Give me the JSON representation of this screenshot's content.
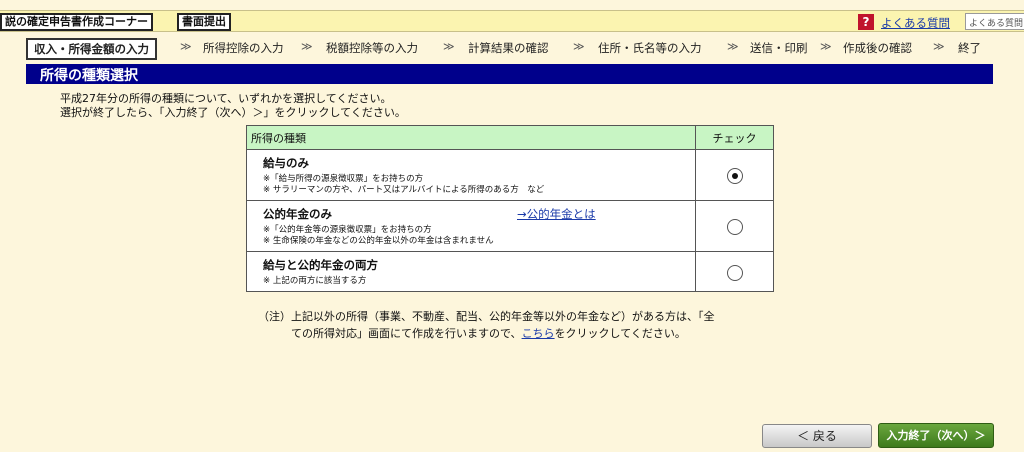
{
  "top": {
    "corner_title": "説の確定申告書作成コーナー",
    "submit_button": "書面提出",
    "faq_icon": "?",
    "faq_link": "よくある質問",
    "search_placeholder": "よくある質問"
  },
  "steps": [
    {
      "label": "収入・所得金額の入力",
      "active": true
    },
    {
      "label": "所得控除の入力"
    },
    {
      "label": "税額控除等の入力"
    },
    {
      "label": "計算結果の確認"
    },
    {
      "label": "住所・氏名等の入力"
    },
    {
      "label": "送信・印刷"
    },
    {
      "label": "作成後の確認"
    },
    {
      "label": "終了"
    }
  ],
  "step_separator": "≫",
  "page_title": "所得の種類選択",
  "intro": {
    "line1": "平成27年分の所得の種類について、いずれかを選択してください。",
    "line2": "選択が終了したら、「入力終了（次へ）＞」をクリックしてください。"
  },
  "table": {
    "header_type": "所得の種類",
    "header_check": "チェック",
    "rows": [
      {
        "title": "給与のみ",
        "notes": [
          "※「給与所得の源泉徴収票」をお持ちの方",
          "※ サラリーマンの方や、パート又はアルバイトによる所得のある方　など"
        ],
        "checked": true
      },
      {
        "title": "公的年金のみ",
        "link": "→公的年金とは",
        "notes": [
          "※「公的年金等の源泉徴収票」をお持ちの方",
          "※ 生命保険の年金などの公的年金以外の年金は含まれません"
        ],
        "checked": false
      },
      {
        "title": "給与と公的年金の両方",
        "notes": [
          "※ 上記の両方に該当する方"
        ],
        "checked": false
      }
    ]
  },
  "note": {
    "line1": "（注）上記以外の所得（事業、不動産、配当、公的年金等以外の年金など）がある方は、「全",
    "line2_before": "ての所得対応」画面にて作成を行いますので、",
    "link": "こちら",
    "line2_after": "をクリックしてください。"
  },
  "buttons": {
    "back": "＜ 戻る",
    "next": "入力終了（次へ）＞"
  },
  "colors": {
    "header_band": "#00008b",
    "table_header": "#c8f5c4",
    "next_button": "#4f8e2a",
    "background": "#fdf6dc"
  }
}
